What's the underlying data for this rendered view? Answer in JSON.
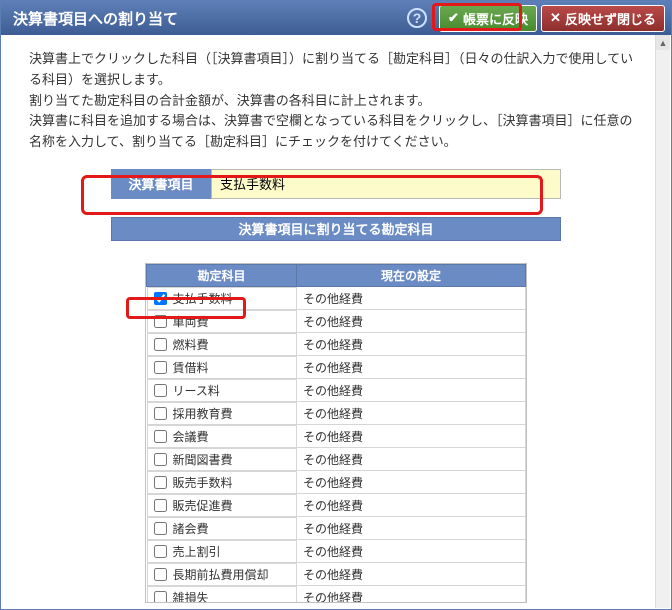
{
  "titlebar": {
    "title": "決算書項目への割り当て",
    "apply_label": "帳票に反映",
    "close_label": "反映せず閉じる"
  },
  "instructions": {
    "line1": "決算書上でクリックした科目（［決算書項目］）に割り当てる［勘定科目］（日々の仕訳入力で使用している科目）を選択します。",
    "line2": "割り当てた勘定科目の合計金額が、決算書の各科目に計上されます。",
    "line3": "決算書に科目を追加する場合は、決算書で空欄となっている科目をクリックし、［決算書項目］に任意の名称を入力して、割り当てる［勘定科目］にチェックを付けてください。"
  },
  "field": {
    "label": "決算書項目",
    "value": "支払手数料"
  },
  "section_header": "決算書項目に割り当てる勘定科目",
  "table": {
    "col_account": "勘定科目",
    "col_setting": "現在の設定",
    "rows": [
      {
        "checked": true,
        "name": "支払手数料",
        "setting": "その他経費"
      },
      {
        "checked": false,
        "name": "車両費",
        "setting": "その他経費"
      },
      {
        "checked": false,
        "name": "燃料費",
        "setting": "その他経費"
      },
      {
        "checked": false,
        "name": "賃借料",
        "setting": "その他経費"
      },
      {
        "checked": false,
        "name": "リース料",
        "setting": "その他経費"
      },
      {
        "checked": false,
        "name": "採用教育費",
        "setting": "その他経費"
      },
      {
        "checked": false,
        "name": "会議費",
        "setting": "その他経費"
      },
      {
        "checked": false,
        "name": "新聞図書費",
        "setting": "その他経費"
      },
      {
        "checked": false,
        "name": "販売手数料",
        "setting": "その他経費"
      },
      {
        "checked": false,
        "name": "販売促進費",
        "setting": "その他経費"
      },
      {
        "checked": false,
        "name": "諸会費",
        "setting": "その他経費"
      },
      {
        "checked": false,
        "name": "売上割引",
        "setting": "その他経費"
      },
      {
        "checked": false,
        "name": "長期前払費用償却",
        "setting": "その他経費"
      },
      {
        "checked": false,
        "name": "雑損失",
        "setting": "その他経費"
      }
    ]
  }
}
